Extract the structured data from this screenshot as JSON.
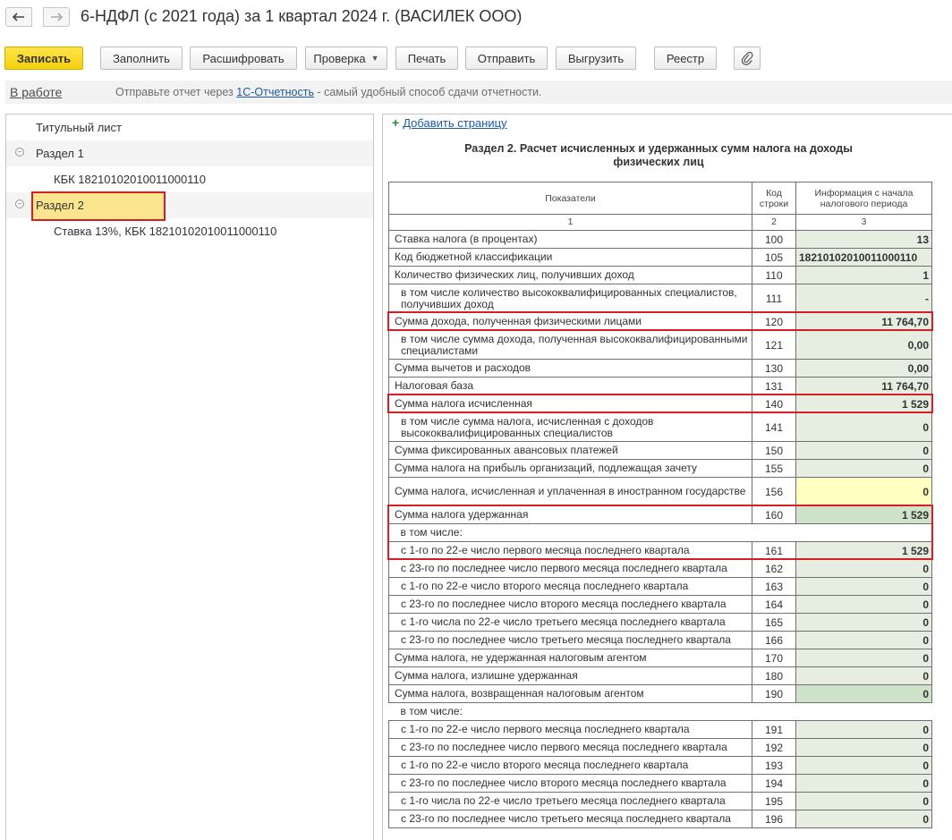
{
  "window": {
    "title": "6-НДФЛ (с 2021 года) за 1 квартал 2024 г. (ВАСИЛЕК ООО)",
    "back_icon": "arrow-left-icon",
    "forward_icon": "arrow-right-icon"
  },
  "toolbar": {
    "save": "Записать",
    "fill": "Заполнить",
    "decode": "Расшифровать",
    "check": "Проверка",
    "print": "Печать",
    "send": "Отправить",
    "export": "Выгрузить",
    "registry": "Реестр",
    "attach_icon": "paperclip-icon"
  },
  "infobar": {
    "status": "В работе",
    "text_before": "Отправьте отчет через ",
    "link": "1С-Отчетность",
    "text_after": " - самый удобный способ сдачи отчетности."
  },
  "tree": {
    "items": [
      {
        "label": "Титульный лист"
      },
      {
        "label": "Раздел 1"
      },
      {
        "label": "КБК 18210102010011000110"
      },
      {
        "label": "Раздел 2"
      },
      {
        "label": "Ставка 13%, КБК 18210102010011000110"
      }
    ]
  },
  "form": {
    "add_page": "Добавить страницу",
    "section_title": "Раздел 2. Расчет исчисленных и удержанных сумм налога на доходы физических лиц",
    "headers": {
      "indicators": "Показатели",
      "code": "Код строки",
      "info": "Информация с начала налогового периода",
      "n1": "1",
      "n2": "2",
      "n3": "3"
    },
    "rows": [
      {
        "label": "Ставка налога (в процентах)",
        "code": "100",
        "value": "13"
      },
      {
        "label": "Код бюджетной классификации",
        "code": "105",
        "value": "18210102010011000110"
      },
      {
        "label": "Количество физических лиц, получивших доход",
        "code": "110",
        "value": "1"
      },
      {
        "label": "в том числе количество высококвалифицированных специалистов, получивших доход",
        "code": "111",
        "value": "-"
      },
      {
        "label": "Сумма дохода, полученная физическими лицами",
        "code": "120",
        "value": "11 764,70"
      },
      {
        "label": "в том числе сумма дохода, полученная высококвалифицированными специалистами",
        "code": "121",
        "value": "0,00"
      },
      {
        "label": "Сумма вычетов и расходов",
        "code": "130",
        "value": "0,00"
      },
      {
        "label": "Налоговая база",
        "code": "131",
        "value": "11 764,70"
      },
      {
        "label": "Сумма налога исчисленная",
        "code": "140",
        "value": "1 529"
      },
      {
        "label": "в том числе сумма налога, исчисленная с доходов высококвалифицированных специалистов",
        "code": "141",
        "value": "0"
      },
      {
        "label": "Сумма фиксированных авансовых платежей",
        "code": "150",
        "value": "0"
      },
      {
        "label": "Сумма налога на прибыль организаций, подлежащая зачету",
        "code": "155",
        "value": "0"
      },
      {
        "label": "Сумма налога, исчисленная и уплаченная в иностранном государстве",
        "code": "156",
        "value": "0"
      },
      {
        "label": "Сумма налога удержанная",
        "code": "160",
        "value": "1 529"
      },
      {
        "label": "в том числе:"
      },
      {
        "label": "с 1-го по 22-е число первого месяца последнего квартала",
        "code": "161",
        "value": "1 529"
      },
      {
        "label": "с 23-го по последнее число первого месяца последнего квартала",
        "code": "162",
        "value": "0"
      },
      {
        "label": "с 1-го по 22-е число второго месяца последнего квартала",
        "code": "163",
        "value": "0"
      },
      {
        "label": "с 23-го по последнее число второго месяца последнего квартала",
        "code": "164",
        "value": "0"
      },
      {
        "label": "с 1-го числа по 22-е число третьего месяца последнего квартала",
        "code": "165",
        "value": "0"
      },
      {
        "label": "с 23-го по последнее число третьего месяца последнего квартала",
        "code": "166",
        "value": "0"
      },
      {
        "label": "Сумма налога, не удержанная налоговым агентом",
        "code": "170",
        "value": "0"
      },
      {
        "label": "Сумма налога, излишне удержанная",
        "code": "180",
        "value": "0"
      },
      {
        "label": "Сумма налога, возвращенная налоговым агентом",
        "code": "190",
        "value": "0"
      },
      {
        "label": "в том числе:"
      },
      {
        "label": "с 1-го по 22-е число первого месяца последнего квартала",
        "code": "191",
        "value": "0"
      },
      {
        "label": "с 23-го по последнее число первого месяца последнего квартала",
        "code": "192",
        "value": "0"
      },
      {
        "label": "с 1-го по 22-е число второго месяца последнего квартала",
        "code": "193",
        "value": "0"
      },
      {
        "label": "с 23-го по последнее число второго месяца последнего квартала",
        "code": "194",
        "value": "0"
      },
      {
        "label": "с 1-го числа по 22-е число третьего месяца последнего квартала",
        "code": "195",
        "value": "0"
      },
      {
        "label": "с 23-го по последнее число третьего месяца последнего квартала",
        "code": "196",
        "value": "0"
      }
    ]
  }
}
